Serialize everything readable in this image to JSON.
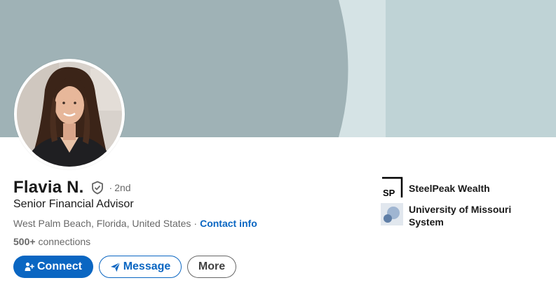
{
  "profile": {
    "name": "Flavia N.",
    "degree_dot": "·",
    "degree": "2nd",
    "headline": "Senior Financial Advisor",
    "location": "West Palm Beach, Florida, United States",
    "location_sep": "·",
    "contact_info_label": "Contact info",
    "connections_count": "500+",
    "connections_label": "connections"
  },
  "actions": {
    "connect_label": "Connect",
    "message_label": "Message",
    "more_label": "More"
  },
  "organizations": [
    {
      "name": "SteelPeak Wealth",
      "logo_text": "SP",
      "icon": "steelpeak-logo"
    },
    {
      "name": "University of Missouri System",
      "icon": "university-logo"
    }
  ],
  "icons": {
    "verified": "shield-check-icon",
    "connect": "add-person-icon",
    "message": "paper-plane-icon"
  },
  "colors": {
    "brand_blue": "#0a66c2",
    "banner_dark": "#9fb2b6",
    "banner_light": "#bfd3d6"
  }
}
